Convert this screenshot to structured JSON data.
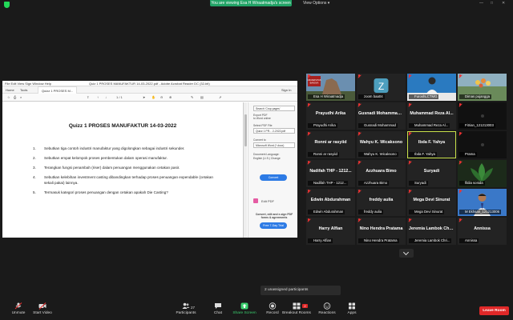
{
  "topbar": {
    "banner": "You are viewing Esa H Wiraatmadja's screen",
    "view_options": "View Options",
    "colors": {
      "banner": "#21a366",
      "shield": "#23d959"
    }
  },
  "acrobat": {
    "menu": "File   Edit   View   Sign   Window   Help",
    "title": "Quiz 1 PROSES MANUFAKTUR 14-03-2022.pdf - Adobe Acrobat Reader DC (32-bit)",
    "tab_home": "Home",
    "tab_tools": "Tools",
    "doc_tab": "Quizz 1 PROSES M...",
    "sign_in": "Sign In",
    "page_indicator": "1 / 1",
    "doc_title": "Quizz 1 PROSES MANUFAKTUR 14-03-2022",
    "questions": [
      {
        "n": "1.",
        "text": "Sebutkan tiga contoh industri manufaktur yang digolongkan sebagai industri sekunder."
      },
      {
        "n": "2.",
        "text": "Sebutkan empat kelompok proses pembentukan dalam operasi manufaktur."
      },
      {
        "n": "3.",
        "text": "Terangkan fungsi penambah (riser) dalam penuangan menggunakan cetakan pasir."
      },
      {
        "n": "4.",
        "text": "Sebutkan kelebihan investment casting dibandingkan terhadap proses penuangan expendable (cetakan sekali pakai) lainnya."
      },
      {
        "n": "5.",
        "text": "Termasuk kategori proses penuangan dengan cetakan apakah Die Casting?"
      }
    ],
    "panel": {
      "search": "Search 'Crop pages'",
      "export_label": "Export PDF",
      "to_word": "to Word online",
      "select_label": "Select PDF File",
      "file": "Quizz 1 PR... 2-2022.pdf",
      "convert_to": "Convert to",
      "format": "Microsoft Word (*.docx)",
      "doc_language": "Document Language:",
      "language": "English (U.S.)  Change",
      "convert_btn": "Convert",
      "edit_pdf": "Edit PDF",
      "promo": "Convert, edit and e-sign PDF forms & agreements",
      "trial_btn": "Free 7-Day Trial"
    }
  },
  "participants": [
    {
      "label": "Esa H Wiraatmadja",
      "name": "",
      "kind": "photo-building"
    },
    {
      "label": "zoom baa04",
      "name": "",
      "kind": "avatar-z"
    },
    {
      "label": "FuroshLCTMG",
      "name": "",
      "kind": "photo-person"
    },
    {
      "label": "Dimas pujangga",
      "name": "",
      "kind": "photo-flowers"
    },
    {
      "label": "Prayudhi Arika",
      "name": "Prayudhi Arika",
      "kind": "name"
    },
    {
      "label": "Gusnadi Mohammad",
      "name": "Gusnadi Mohammad ...",
      "kind": "name"
    },
    {
      "label": "Muhammad Reza Al...",
      "name": "Muhammad Reza Al...",
      "kind": "name"
    },
    {
      "label": "Fitrian_121213003",
      "name": "",
      "kind": "photo-dark"
    },
    {
      "label": "Ronni ar rasyiid",
      "name": "Ronni ar rasyiid",
      "kind": "name"
    },
    {
      "label": "Wahyu K. Wicaksono",
      "name": "Wahyu K. Wicaksono",
      "kind": "name"
    },
    {
      "label": "Ibda F. Yahya",
      "name": "Ibda F. Yahya",
      "kind": "name",
      "active": true
    },
    {
      "label": "Prama",
      "name": "",
      "kind": "photo-dark"
    },
    {
      "label": "Nadifah THP - 1212...",
      "name": "Nadifah THP - 1212...",
      "kind": "name"
    },
    {
      "label": "Azzhuara Bimo",
      "name": "Azzhuara Bimo",
      "kind": "name"
    },
    {
      "label": "Suryadi",
      "name": "Suryadi",
      "kind": "name"
    },
    {
      "label": "fildia sonida",
      "name": "",
      "kind": "photo-plant"
    },
    {
      "label": "Edwin Abdurahman",
      "name": "Edwin Abdurahman",
      "kind": "name"
    },
    {
      "label": "freddy aulia",
      "name": "freddy aulia",
      "kind": "name"
    },
    {
      "label": "Mega Devi Sinurat",
      "name": "Mega Devi Sinurat",
      "kind": "name"
    },
    {
      "label": "M Ekhsan_121213006",
      "name": "",
      "kind": "photo-man"
    },
    {
      "label": "Harry Alfian",
      "name": "Harry Alfian",
      "kind": "name"
    },
    {
      "label": "Nino Hendra Pratama",
      "name": "Nino Hendra Pratama",
      "kind": "name"
    },
    {
      "label": "Jeremia Lambok Chri...",
      "name": "Jeremia Lambok Chri...",
      "kind": "name"
    },
    {
      "label": "Annissa",
      "name": "Annissa",
      "kind": "name"
    }
  ],
  "unassigned": "2 unassigned participants",
  "toolbar": {
    "unmute": "Unmute",
    "start_video": "Start Video",
    "participants": "Participants",
    "participants_count": "27",
    "chat": "Chat",
    "share_screen": "Share Screen",
    "record": "Record",
    "breakout": "Breakout Rooms",
    "breakout_badge": "2",
    "reactions": "Reactions",
    "apps": "Apps",
    "leave": "Leave Room",
    "colors": {
      "leave": "#e02828",
      "share": "#3bd16f"
    }
  }
}
